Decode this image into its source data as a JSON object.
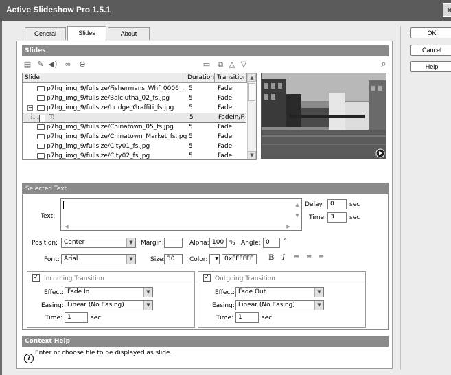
{
  "window": {
    "title": "Active Slideshow Pro 1.5.1"
  },
  "tabs": [
    {
      "label": "General"
    },
    {
      "label": "Slides"
    },
    {
      "label": "About"
    }
  ],
  "buttons": {
    "ok": "OK",
    "cancel": "Cancel",
    "help": "Help"
  },
  "slides": {
    "header": "Slides",
    "columns": [
      "Slide",
      "Duration",
      "Transition"
    ],
    "rows": [
      {
        "name": "p7hg_img_9/fullsize/Fishermans_Whf_0006_...",
        "duration": "5",
        "transition": "Fade"
      },
      {
        "name": "p7hg_img_9/fullsize/Balclutha_02_fs.jpg",
        "duration": "5",
        "transition": "Fade"
      },
      {
        "name": "p7hg_img_9/fullsize/bridge_Graffiti_fs.jpg",
        "duration": "5",
        "transition": "Fade"
      },
      {
        "name": "T:",
        "duration": "5",
        "transition": "FadeIn/F..."
      },
      {
        "name": "p7hg_img_9/fullsize/Chinatown_05_fs.jpg",
        "duration": "5",
        "transition": "Fade"
      },
      {
        "name": "p7hg_img_9/fullsize/Chinatown_Market_fs.jpg",
        "duration": "5",
        "transition": "Fade"
      },
      {
        "name": "p7hg_img_9/fullsize/City01_fs.jpg",
        "duration": "5",
        "transition": "Fade"
      },
      {
        "name": "p7hg_img_9/fullsize/City02_fs.jpg",
        "duration": "5",
        "transition": "Fade"
      }
    ]
  },
  "selected_text": {
    "header": "Selected Text",
    "text_label": "Text:",
    "text_value": "",
    "delay_label": "Delay:",
    "delay_value": "0",
    "delay_unit": "sec",
    "time_label": "Time:",
    "time_value": "3",
    "time_unit": "sec",
    "position_label": "Position:",
    "position_value": "Center",
    "margin_label": "Margin:",
    "margin_value": "",
    "alpha_label": "Alpha:",
    "alpha_value": "100",
    "alpha_unit": "%",
    "angle_label": "Angle:",
    "angle_value": "0",
    "angle_unit": "°",
    "font_label": "Font:",
    "font_value": "Arial",
    "size_label": "Size:",
    "size_value": "30",
    "color_label": "Color:",
    "color_value": "0xFFFFFF",
    "bold_glyph": "B",
    "italic_glyph": "I"
  },
  "incoming": {
    "title": "Incoming Transition",
    "checked": true,
    "effect_label": "Effect:",
    "effect_value": "Fade In",
    "easing_label": "Easing:",
    "easing_value": "Linear (No Easing)",
    "time_label": "Time:",
    "time_value": "1",
    "time_unit": "sec"
  },
  "outgoing": {
    "title": "Outgoing Transition",
    "checked": true,
    "effect_label": "Effect:",
    "effect_value": "Fade Out",
    "easing_label": "Easing:",
    "easing_value": "Linear (No Easing)",
    "time_label": "Time:",
    "time_value": "1",
    "time_unit": "sec"
  },
  "context_help": {
    "header": "Context Help",
    "text": "Enter or choose file to be displayed as slide."
  },
  "icons": {
    "toolbar_left": [
      "add-slide-icon",
      "edit-icon",
      "sound-icon",
      "link-icon",
      "remove-icon"
    ],
    "toolbar_right": [
      "folder-icon",
      "import-icon",
      "move-up-icon",
      "move-down-icon"
    ],
    "search": "search-icon"
  }
}
